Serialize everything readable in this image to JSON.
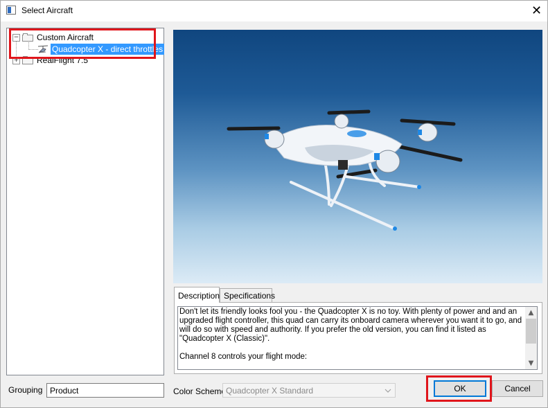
{
  "window": {
    "title": "Select Aircraft",
    "close_glyph": "✕"
  },
  "tree": {
    "items": [
      {
        "label": "Custom Aircraft",
        "expander": "−",
        "type": "folder"
      },
      {
        "label": "Quadcopter X - direct throttles",
        "type": "aircraft",
        "selected": true
      },
      {
        "label": "RealFlight 7.5",
        "expander": "+",
        "type": "folder"
      }
    ]
  },
  "grouping": {
    "label": "Grouping",
    "value": "Product"
  },
  "tabs": [
    {
      "label": "Description",
      "active": true
    },
    {
      "label": "Specifications",
      "active": false
    }
  ],
  "description": {
    "paragraphs": [
      "Don't let its friendly looks fool you - the Quadcopter X is no toy.  With plenty of power and and an upgraded flight controller, this quad can carry its onboard camera wherever you want it to go, and will do so with speed and authority. If you prefer the old version, you can find it listed as \"Quadcopter X (Classic)\".",
      "Channel 8 controls your flight mode:"
    ]
  },
  "color_scheme": {
    "label": "Color Scheme",
    "value": "Quadcopter X Standard",
    "disabled": true
  },
  "buttons": {
    "ok": "OK",
    "cancel": "Cancel"
  },
  "colors": {
    "highlight": "#e0151b",
    "selection": "#3399ff",
    "default_button_border": "#0078d7"
  },
  "icons": {
    "window": "window-icon",
    "folder": "folder-icon",
    "aircraft": "helicopter-icon"
  }
}
